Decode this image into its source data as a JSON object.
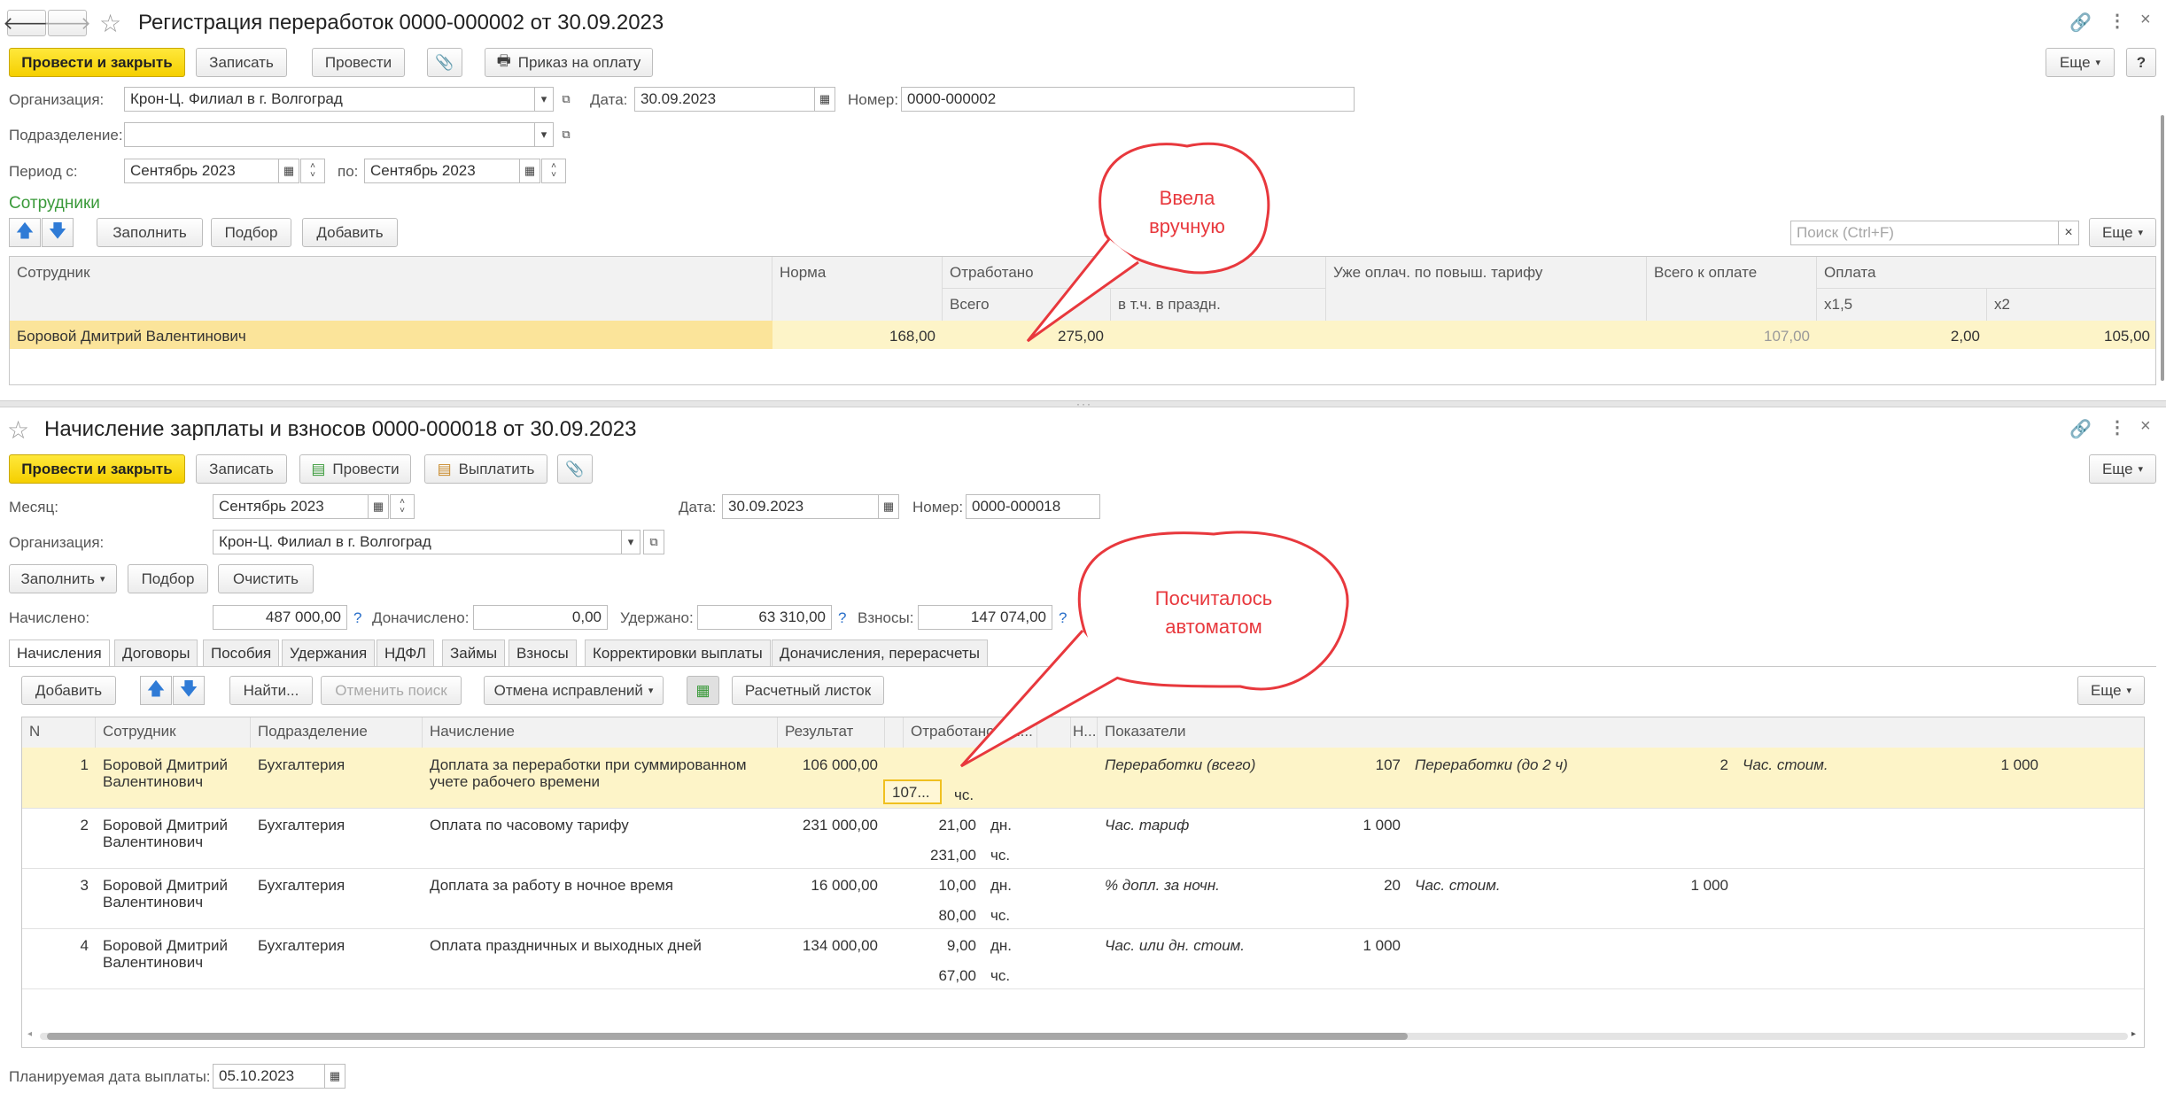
{
  "doc1": {
    "title": "Регистрация переработок 0000-000002 от 30.09.2023",
    "toolbar": {
      "post_close": "Провести и закрыть",
      "save": "Записать",
      "post": "Провести",
      "pay_order": "Приказ на оплату",
      "more": "Еще",
      "help": "?"
    },
    "org_label": "Организация:",
    "org_value": "Крон-Ц. Филиал в г. Волгоград",
    "date_label": "Дата:",
    "date_value": "30.09.2023",
    "number_label": "Номер:",
    "number_value": "0000-000002",
    "dept_label": "Подразделение:",
    "period_label": "Период с:",
    "period_from": "Сентябрь 2023",
    "period_to_label": "по:",
    "period_to": "Сентябрь 2023",
    "section_title": "Сотрудники",
    "grid_toolbar": {
      "fill": "Заполнить",
      "pick": "Подбор",
      "add": "Добавить",
      "search_placeholder": "Поиск (Ctrl+F)",
      "more": "Еще"
    },
    "columns": {
      "employee": "Сотрудник",
      "norm": "Норма",
      "worked": "Отработано",
      "worked_total": "Всего",
      "worked_holiday": "в т.ч. в праздн.",
      "already_paid": "Уже оплач. по повыш. тарифу",
      "total_pay": "Всего к оплате",
      "pay": "Оплата",
      "x15": "х1,5",
      "x2": "х2"
    },
    "rows": [
      {
        "employee": "Боровой Дмитрий Валентинович",
        "norm": "168,00",
        "worked_total": "275,00",
        "worked_holiday": "",
        "already_paid": "",
        "total_pay": "107,00",
        "x15": "2,00",
        "x2": "105,00"
      }
    ]
  },
  "callout1": {
    "line1": "Ввела",
    "line2": "вручную"
  },
  "doc2": {
    "title": "Начисление зарплаты и взносов 0000-000018 от 30.09.2023",
    "toolbar": {
      "post_close": "Провести и закрыть",
      "save": "Записать",
      "post": "Провести",
      "pay": "Выплатить",
      "more": "Еще"
    },
    "month_label": "Месяц:",
    "month_value": "Сентябрь 2023",
    "date_label": "Дата:",
    "date_value": "30.09.2023",
    "number_label": "Номер:",
    "number_value": "0000-000018",
    "org_label": "Организация:",
    "org_value": "Крон-Ц. Филиал в г. Волгоград",
    "actions": {
      "fill": "Заполнить",
      "pick": "Подбор",
      "clear": "Очистить"
    },
    "totals": {
      "accrued_label": "Начислено:",
      "accrued_value": "487 000,00",
      "extra_label": "Доначислено:",
      "extra_value": "0,00",
      "withheld_label": "Удержано:",
      "withheld_value": "63 310,00",
      "contrib_label": "Взносы:",
      "contrib_value": "147 074,00",
      "q": "?"
    },
    "tabs": [
      "Начисления",
      "Договоры",
      "Пособия",
      "Удержания",
      "НДФЛ",
      "Займы",
      "Взносы",
      "Корректировки выплаты",
      "Доначисления, перерасчеты"
    ],
    "grid_toolbar": {
      "add": "Добавить",
      "find": "Найти...",
      "cancel_search": "Отменить поиск",
      "undo_fixes": "Отмена исправлений",
      "payslip": "Расчетный листок",
      "more": "Еще"
    },
    "columns": {
      "n": "N",
      "employee": "Сотрудник",
      "dept": "Подразделение",
      "accrual": "Начисление",
      "result": "Результат",
      "worked": "Отработано (оп...",
      "h": "Н...",
      "indicators": "Показатели"
    },
    "rows": [
      {
        "n": "1",
        "employee": "Боровой Дмитрий Валентинович",
        "dept": "Бухгалтерия",
        "accrual": "Доплата за переработки при суммированном учете рабочего времени",
        "result": "106 000,00",
        "worked1": "",
        "unit1": "",
        "worked2": "107...",
        "unit2": "чс.",
        "ind": [
          {
            "name": "Переработки (всего)",
            "value": "107"
          },
          {
            "name": "Переработки (до 2 ч)",
            "value": "2"
          },
          {
            "name": "Час. стоим.",
            "value": "1 000"
          }
        ]
      },
      {
        "n": "2",
        "employee": "Боровой Дмитрий Валентинович",
        "dept": "Бухгалтерия",
        "accrual": "Оплата по часовому тарифу",
        "result": "231 000,00",
        "worked1": "21,00",
        "unit1": "дн.",
        "worked2": "231,00",
        "unit2": "чс.",
        "ind": [
          {
            "name": "Час. тариф",
            "value": "1 000"
          }
        ]
      },
      {
        "n": "3",
        "employee": "Боровой Дмитрий Валентинович",
        "dept": "Бухгалтерия",
        "accrual": "Доплата за работу в ночное время",
        "result": "16 000,00",
        "worked1": "10,00",
        "unit1": "дн.",
        "worked2": "80,00",
        "unit2": "чс.",
        "ind": [
          {
            "name": "% допл. за ночн.",
            "value": "20"
          },
          {
            "name": "Час. стоим.",
            "value": "1 000"
          }
        ]
      },
      {
        "n": "4",
        "employee": "Боровой Дмитрий Валентинович",
        "dept": "Бухгалтерия",
        "accrual": "Оплата праздничных и выходных дней",
        "result": "134 000,00",
        "worked1": "9,00",
        "unit1": "дн.",
        "worked2": "67,00",
        "unit2": "чс.",
        "ind": [
          {
            "name": "Час. или дн. стоим.",
            "value": "1 000"
          }
        ]
      }
    ],
    "planned_date_label": "Планируемая дата выплаты:",
    "planned_date_value": "05.10.2023"
  },
  "callout2": {
    "line1": "Посчиталось",
    "line2": "автоматом"
  },
  "colors": {
    "primary": "#f5cf00",
    "selection": "#fdf4c8",
    "callout": "#e8383d",
    "section": "#3a9a3a"
  }
}
